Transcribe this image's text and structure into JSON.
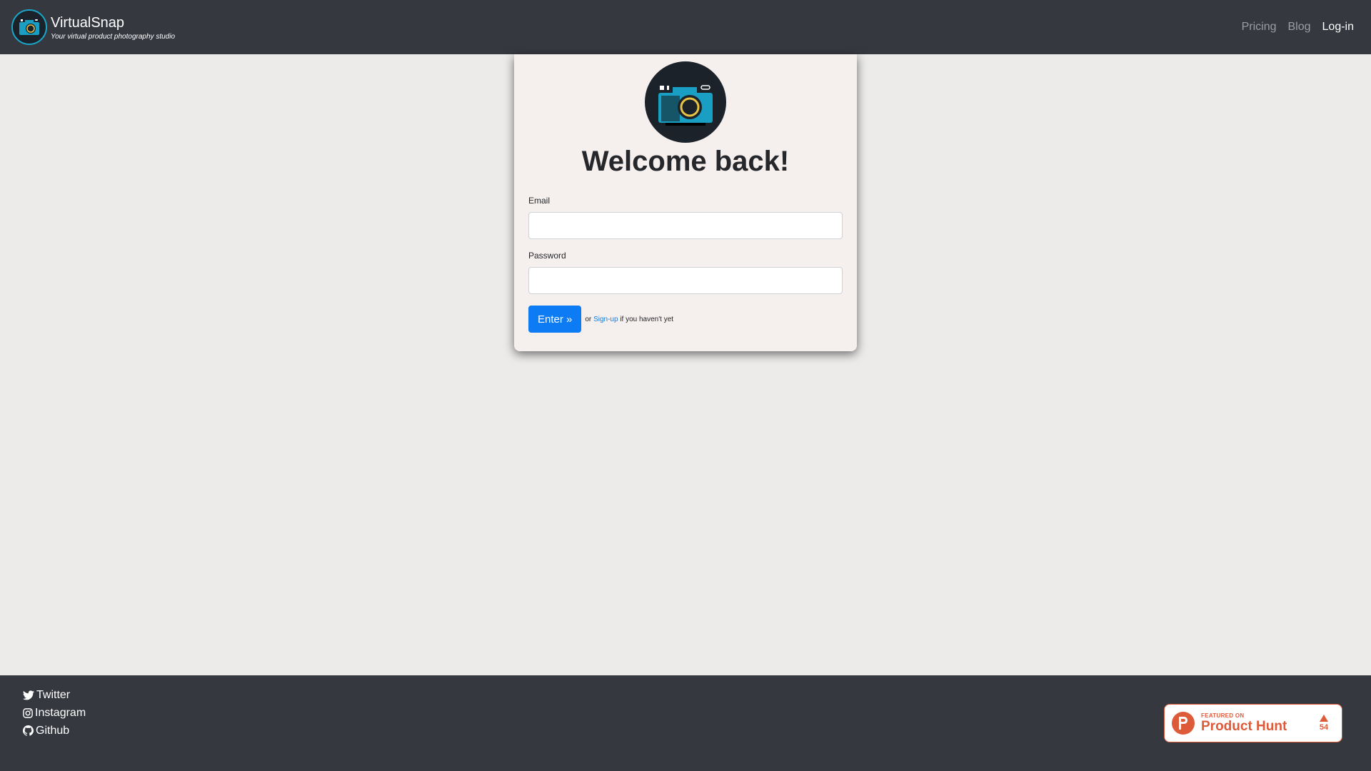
{
  "navbar": {
    "brand_title": "VirtualSnap",
    "brand_tagline": "Your virtual product photography studio",
    "links": [
      "Pricing",
      "Blog",
      "Log-in"
    ],
    "active_link": "Log-in"
  },
  "login": {
    "title": "Welcome back!",
    "email_label": "Email",
    "email_value": "",
    "password_label": "Password",
    "password_value": "",
    "enter_button": "Enter »",
    "signup_prefix": "or",
    "signup_link": "Sign-up",
    "signup_suffix": "if you haven't yet"
  },
  "footer": {
    "links": [
      "Twitter",
      "Instagram",
      "Github"
    ],
    "producthunt": {
      "featured": "FEATURED ON",
      "name": "Product Hunt",
      "votes": "54"
    }
  },
  "colors": {
    "navbar_bg": "#363840",
    "page_bg": "#ecebea",
    "card_bg": "#f5efee",
    "accent": "#0d7bf4",
    "producthunt": "#de5b3a",
    "logo_ring": "#1aa6c8"
  },
  "icons": [
    "camera-logo-icon",
    "twitter-icon",
    "instagram-icon",
    "github-icon",
    "producthunt-logo-icon",
    "upvote-triangle-icon"
  ]
}
